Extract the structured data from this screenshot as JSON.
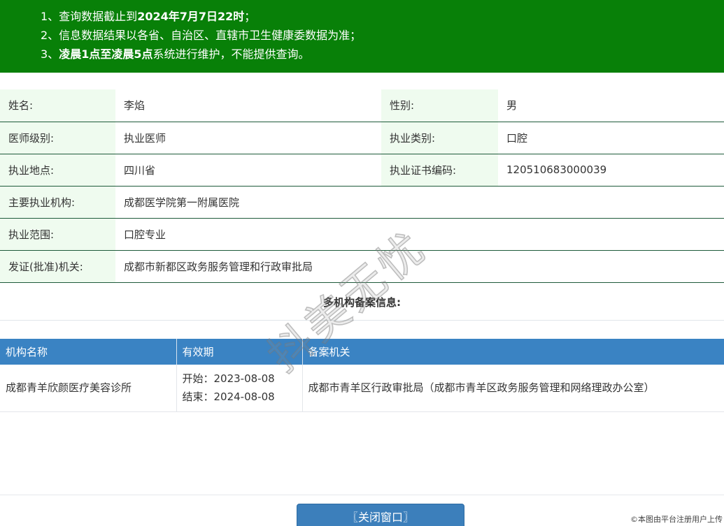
{
  "notice": {
    "line1_prefix": "1、查询数据截止到",
    "line1_bold": "2024年7月7日22时",
    "line1_suffix": "；",
    "line2": "2、信息数据结果以各省、自治区、直辖市卫生健康委数据为准；",
    "line3_prefix": "3、",
    "line3_bold": "凌晨1点至凌晨5点",
    "line3_suffix": "系统进行维护，不能提供查询。"
  },
  "info": {
    "name_label": "姓名:",
    "name_value": "李焰",
    "gender_label": "性别:",
    "gender_value": "男",
    "level_label": "医师级别:",
    "level_value": "执业医师",
    "category_label": "执业类别:",
    "category_value": "口腔",
    "location_label": "执业地点:",
    "location_value": "四川省",
    "cert_label": "执业证书编码:",
    "cert_value": "120510683000039",
    "org_label": "主要执业机构:",
    "org_value": "成都医学院第一附属医院",
    "scope_label": "执业范围:",
    "scope_value": "口腔专业",
    "issuer_label": "发证(批准)机关:",
    "issuer_value": "成都市新都区政务服务管理和行政审批局"
  },
  "multi": {
    "title": "多机构备案信息:",
    "headers": [
      "机构名称",
      "有效期",
      "备案机关"
    ],
    "rows": [
      {
        "org": "成都青羊欣颜医疗美容诊所",
        "start": "开始：2023-08-08",
        "end": "结束：2024-08-08",
        "authority": "成都市青羊区行政审批局（成都市青羊区政务服务管理和网络理政办公室）"
      }
    ]
  },
  "close_button": "〖关闭窗口〗",
  "watermark": "抖美无忧",
  "corner_mark": "©本图由平台注册用户上传",
  "colors": {
    "notice_bg": "#088008",
    "header_bg": "#3a83c3",
    "label_bg": "#effbef",
    "button_bg": "#3c7fbb"
  }
}
